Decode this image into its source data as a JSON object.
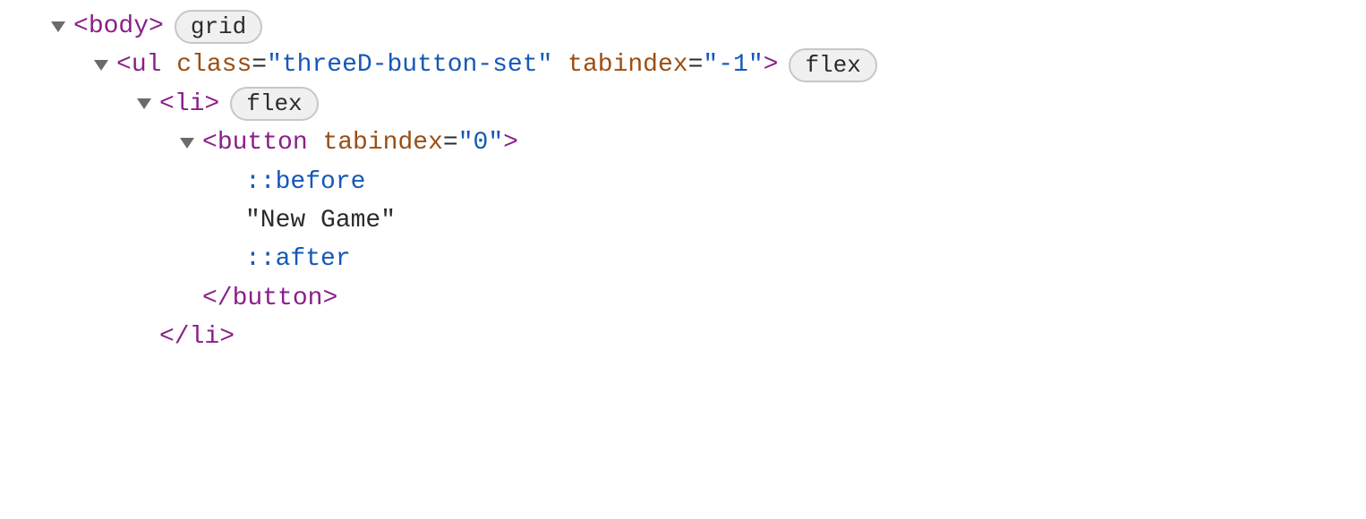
{
  "tree": {
    "line1": {
      "tag": "body",
      "badge": "grid"
    },
    "line2": {
      "tag": "ul",
      "attr_class_name": "class",
      "attr_class_val": "threeD-button-set",
      "attr_tabindex_name": "tabindex",
      "attr_tabindex_val": "-1",
      "badge": "flex"
    },
    "line3": {
      "tag": "li",
      "badge": "flex"
    },
    "line4": {
      "tag": "button",
      "attr_tabindex_name": "tabindex",
      "attr_tabindex_val": "0"
    },
    "line5": {
      "pseudo": "::before"
    },
    "line6": {
      "text": "\"New Game\""
    },
    "line7": {
      "pseudo": "::after"
    },
    "line8": {
      "closeTag": "button"
    },
    "line9": {
      "closeTag": "li"
    }
  }
}
